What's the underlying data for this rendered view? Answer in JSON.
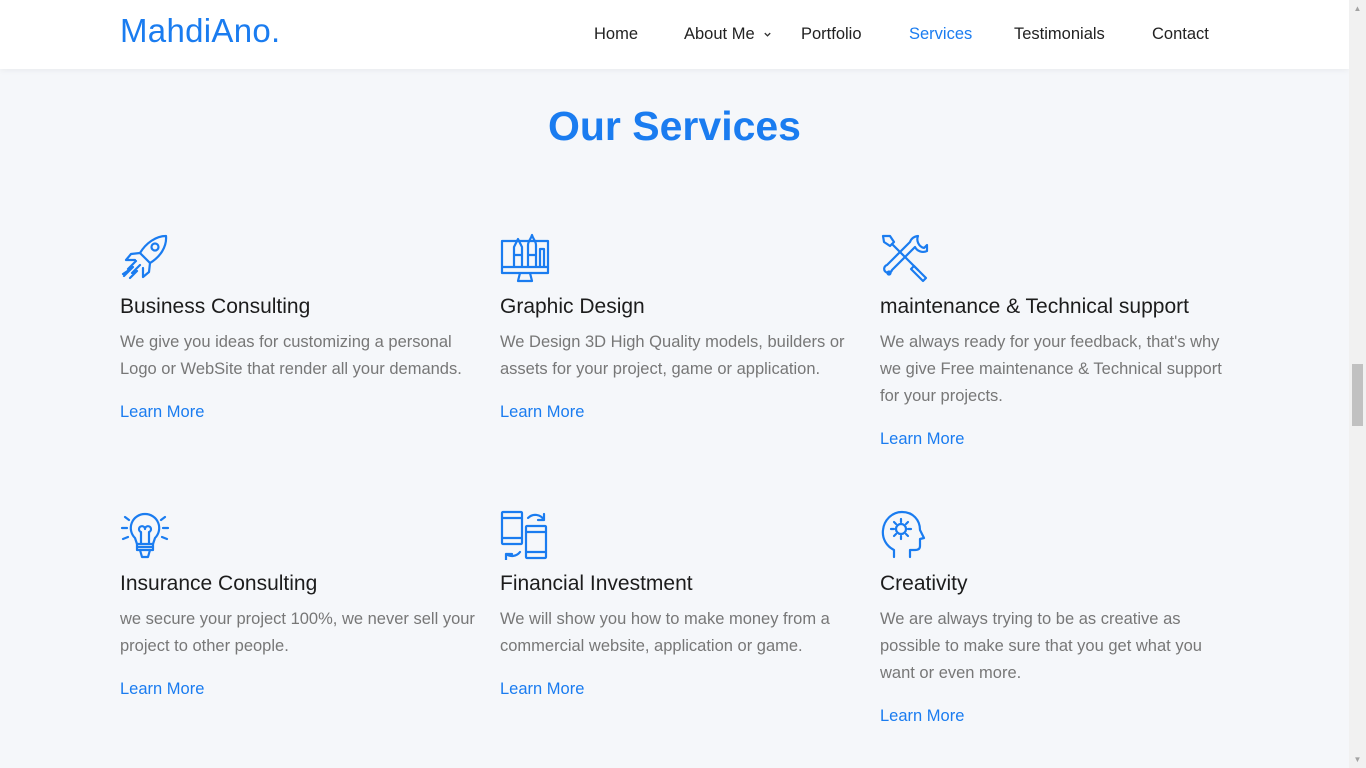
{
  "brand": {
    "logo_text": "MahdiAno."
  },
  "nav": {
    "home": "Home",
    "about": "About Me",
    "portfolio": "Portfolio",
    "services": "Services",
    "testimonials": "Testimonials",
    "contact": "Contact"
  },
  "services": {
    "title": "Our Services",
    "items": [
      {
        "icon": "rocket-icon",
        "title": "Business Consulting",
        "desc": "We give you ideas for customizing a personal Logo or WebSite that render all your demands.",
        "link": "Learn More"
      },
      {
        "icon": "design-monitor-icon",
        "title": "Graphic Design",
        "desc": "We Design 3D High Quality models, builders or assets for your project, game or application.",
        "link": "Learn More"
      },
      {
        "icon": "tools-icon",
        "title": "maintenance & Technical support",
        "desc": "We always ready for your feedback, that's why we give Free maintenance & Technical support for your projects.",
        "link": "Learn More"
      },
      {
        "icon": "lightbulb-icon",
        "title": "Insurance Consulting",
        "desc": "we secure your project 100%, we never sell your project to other people.",
        "link": "Learn More"
      },
      {
        "icon": "devices-sync-icon",
        "title": "Financial Investment",
        "desc": "We will show you how to make money from a commercial website, application or game.",
        "link": "Learn More"
      },
      {
        "icon": "head-gear-icon",
        "title": "Creativity",
        "desc": "We are always trying to be as creative as possible to make sure that you get what you want or even more.",
        "link": "Learn More"
      }
    ]
  },
  "colors": {
    "accent": "#1a7cf0",
    "background": "#f5f7fa",
    "text": "#1c1c1c",
    "muted": "#777777"
  }
}
